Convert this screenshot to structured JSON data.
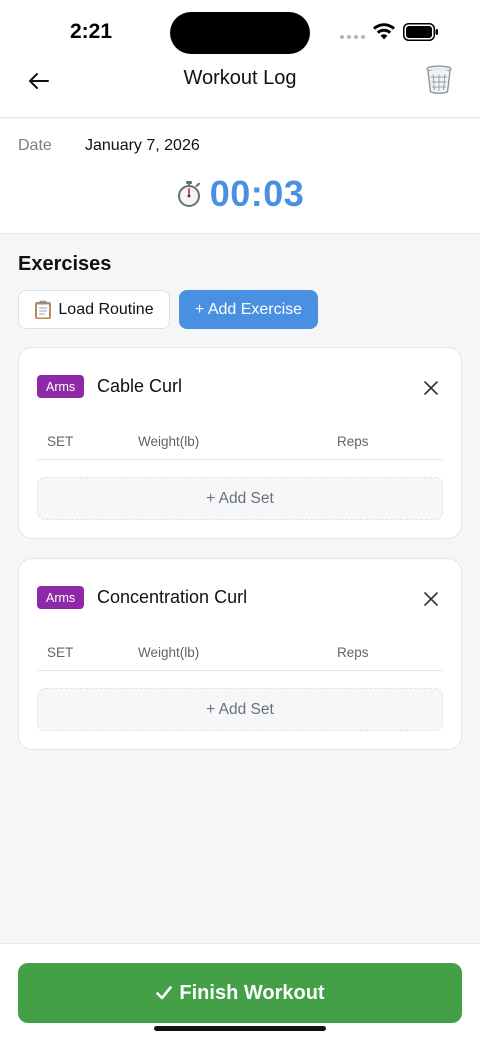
{
  "status_bar": {
    "time": "2:21"
  },
  "header": {
    "title": "Workout Log",
    "back_icon": "arrow-left-icon",
    "trash_icon": "trash-icon"
  },
  "session": {
    "date_label": "Date",
    "date_value": "January 7, 2026",
    "timer_icon": "stopwatch-icon",
    "timer": "00:03"
  },
  "exercises_section": {
    "title": "Exercises",
    "load_routine_label": "Load Routine",
    "add_exercise_label": "+ Add Exercise"
  },
  "exercises": [
    {
      "category": "Arms",
      "name": "Cable Curl",
      "columns": {
        "set": "SET",
        "weight": "Weight(lb)",
        "reps": "Reps"
      },
      "add_set_label": "+ Add Set"
    },
    {
      "category": "Arms",
      "name": "Concentration Curl",
      "columns": {
        "set": "SET",
        "weight": "Weight(lb)",
        "reps": "Reps"
      },
      "add_set_label": "+ Add Set"
    }
  ],
  "footer": {
    "finish_label": "Finish Workout"
  },
  "colors": {
    "accent": "#4a90e2",
    "badge": "#8e2aa8",
    "finish": "#43a047"
  }
}
